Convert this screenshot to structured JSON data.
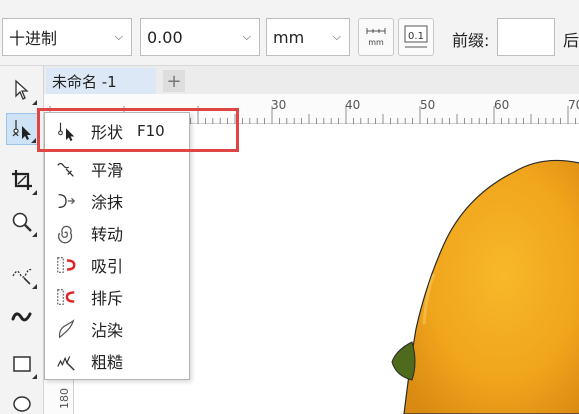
{
  "propbar": {
    "number_system": "十进制",
    "value": "0.00",
    "unit": "mm",
    "prefix_label": "前缀:",
    "suffix_label": "后",
    "icons": [
      "unit-mm-icon",
      "decimal-icon"
    ]
  },
  "document": {
    "tab_label": "未命名 -1",
    "add_tab": "+"
  },
  "ruler": {
    "h_labels": [
      "30",
      "40",
      "50",
      "60",
      "70"
    ],
    "v_label": "180"
  },
  "toolbox": {
    "tools": [
      "pick-tool-icon",
      "shape-tool-icon",
      "crop-tool-icon",
      "zoom-tool-icon",
      "freehand-tool-icon",
      "artistic-media-icon",
      "rectangle-tool-icon",
      "ellipse-tool-icon"
    ]
  },
  "flyout": {
    "items": [
      {
        "label": "形状",
        "shortcut": "F10",
        "icon": "shape-icon"
      },
      {
        "label": "平滑",
        "icon": "smooth-icon"
      },
      {
        "label": "涂抹",
        "icon": "smear-icon"
      },
      {
        "label": "转动",
        "icon": "twirl-icon"
      },
      {
        "label": "吸引",
        "icon": "attract-icon"
      },
      {
        "label": "排斥",
        "icon": "repel-icon"
      },
      {
        "label": "沾染",
        "icon": "smudge-icon"
      },
      {
        "label": "粗糙",
        "icon": "roughen-icon"
      }
    ]
  },
  "colors": {
    "highlight": "#e04545",
    "lemon": "#f2a91f",
    "active_tool": "#cfe3f7"
  }
}
